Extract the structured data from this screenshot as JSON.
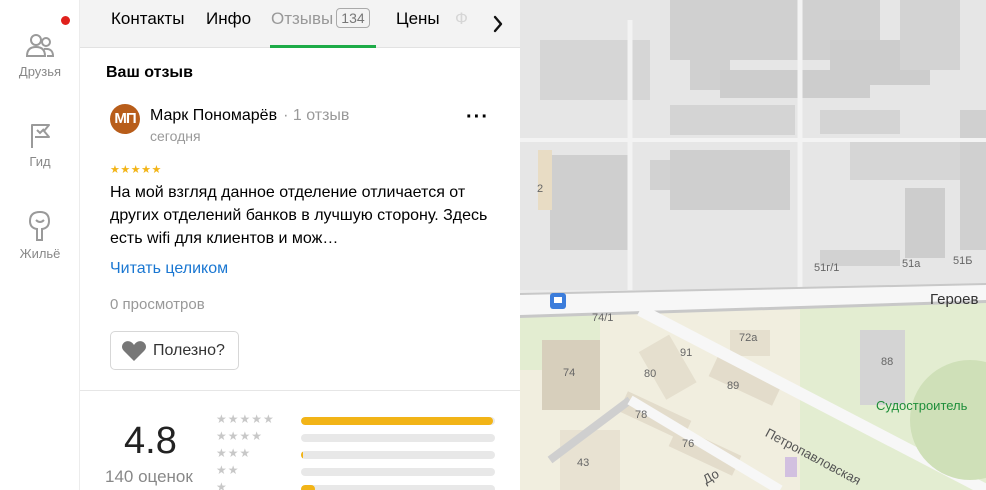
{
  "rail": {
    "items": [
      {
        "label": "Друзья"
      },
      {
        "label": "Гид"
      },
      {
        "label": "Жильё"
      }
    ]
  },
  "tabs": {
    "items": [
      {
        "label": "Контакты"
      },
      {
        "label": "Инфо"
      },
      {
        "label": "Отзывы",
        "count": "134"
      },
      {
        "label": "Цены"
      }
    ],
    "faded": "Ф"
  },
  "review_section": {
    "title": "Ваш отзыв",
    "author": {
      "initials": "МП",
      "name": "Марк Пономарёв",
      "reviews": "· 1 отзыв"
    },
    "date": "сегодня",
    "stars": "★★★★★",
    "text": "На мой взгляд данное отделение отличается от других отделений банков в лучшую сторону. Здесь есть wifi для клиентов и мож…",
    "read_more": "Читать целиком",
    "views": "0 просмотров",
    "useful": "Полезно?"
  },
  "summary": {
    "rating": "4.8",
    "count": "140 оценок",
    "distribution": [
      {
        "stars": "★★★★★",
        "fraction": 0.99
      },
      {
        "stars": "★★★★",
        "fraction": 0.0
      },
      {
        "stars": "★★★",
        "fraction": 0.01
      },
      {
        "stars": "★★",
        "fraction": 0.0
      },
      {
        "stars": "★",
        "fraction": 0.07
      }
    ]
  },
  "map": {
    "labels": {
      "b2": "2",
      "b51g1": "51г/1",
      "b51a": "51а",
      "b51b": "51Б",
      "street_geroev": "Героев",
      "b74_1": "74/1",
      "b72a": "72а",
      "b91": "91",
      "b80": "80",
      "b74": "74",
      "b89": "89",
      "b88": "88",
      "street_petro": "Петропавловская",
      "b78": "78",
      "b76": "76",
      "b43": "43",
      "sudostroitel": "Судостроитель",
      "street_do": "До"
    }
  },
  "colors": {
    "accent_green": "#1dab47",
    "link_blue": "#1a77d2",
    "star_yellow": "#f2b417",
    "notify_red": "#e0211c",
    "avatar_bg": "#b85d1a"
  }
}
